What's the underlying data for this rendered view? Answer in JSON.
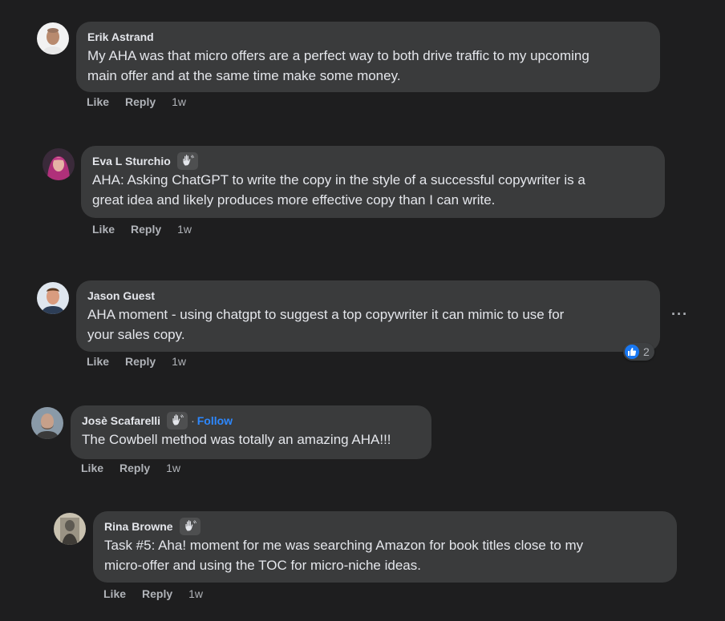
{
  "colors": {
    "background": "#1e1e1f",
    "bubble": "#3a3b3c",
    "text": "#e4e6eb",
    "secondary_text": "#b0b3b8",
    "link": "#2d88ff",
    "like_blue": "#1877f2"
  },
  "comments": [
    {
      "author": "Erik Astrand",
      "badge_icon": null,
      "text_lines": [
        "My AHA was that micro offers are a perfect way to both drive traffic to my upcoming",
        "main offer and at the same time make some money."
      ],
      "like_label": "Like",
      "reply_label": "Reply",
      "time": "1w"
    },
    {
      "author": "Eva L Sturchio",
      "badge_icon": "wave-hand-icon",
      "text_lines": [
        "AHA: Asking ChatGPT to write the copy in the style of a successful copywriter is a",
        "great idea and likely produces more effective copy than I can write."
      ],
      "like_label": "Like",
      "reply_label": "Reply",
      "time": "1w"
    },
    {
      "author": "Jason Guest",
      "badge_icon": null,
      "text_lines": [
        "AHA moment - using chatgpt to suggest a top copywriter it can mimic to use for",
        "your sales copy."
      ],
      "like_label": "Like",
      "reply_label": "Reply",
      "time": "1w",
      "more_label": "···",
      "reaction_icon": "like-thumb-icon",
      "reaction_count": "2"
    },
    {
      "author": "Josè Scafarelli",
      "badge_icon": "wave-hand-icon",
      "separator": "·",
      "follow_label": "Follow",
      "text_lines": [
        "The Cowbell method was totally an amazing AHA!!!"
      ],
      "like_label": "Like",
      "reply_label": "Reply",
      "time": "1w"
    },
    {
      "author": "Rina Browne",
      "badge_icon": "wave-hand-icon",
      "text_lines": [
        "Task #5: Aha! moment for me was searching Amazon for book titles close to my",
        "micro-offer and using the TOC for micro-niche ideas."
      ],
      "like_label": "Like",
      "reply_label": "Reply",
      "time": "1w"
    }
  ]
}
